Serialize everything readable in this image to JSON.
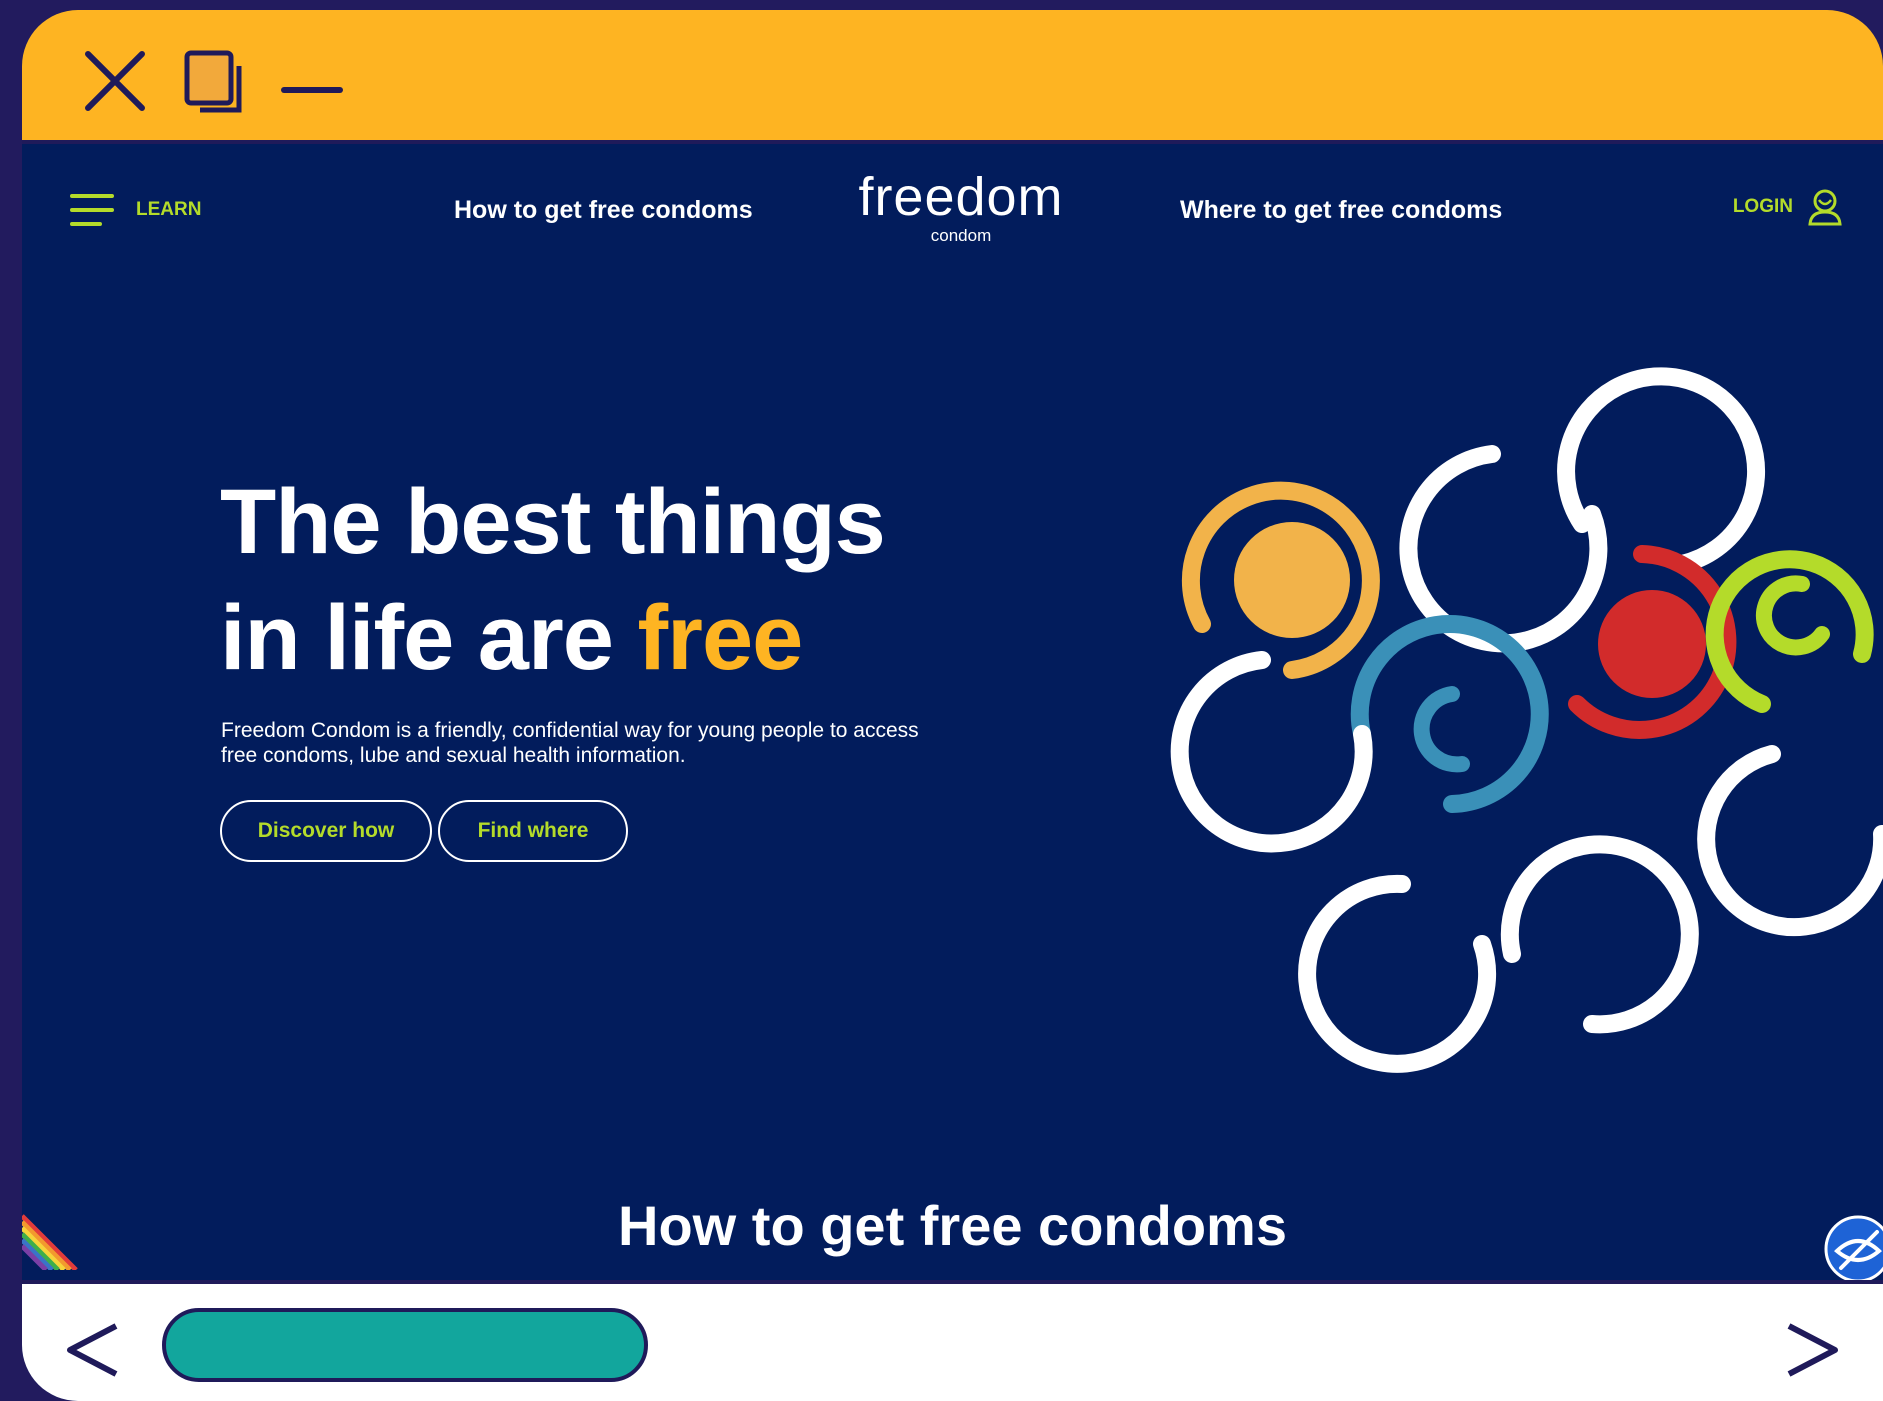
{
  "window": {
    "controls": {
      "close_icon": "close-icon",
      "restore_icon": "restore-icon",
      "minimize_icon": "minimize-icon"
    }
  },
  "nav": {
    "menu_label": "LEARN",
    "link_left": "How to get free condoms",
    "logo_word": "freedom",
    "logo_sub": "condom",
    "link_right": "Where to get free condoms",
    "login_label": "LOGIN"
  },
  "hero": {
    "title_line1": "The best things",
    "title_line2_prefix": "in life are ",
    "title_accent": "free",
    "description": "Freedom Condom is a friendly, confidential way for young people to access free condoms, lube and sexual health information.",
    "btn_discover": "Discover how",
    "btn_find": "Find where"
  },
  "section": {
    "title": "How to get free condoms"
  },
  "colors": {
    "background": "#021c5c",
    "accent_yellow": "#feb422",
    "accent_green": "#b4db2a",
    "titlebar": "#feb422",
    "scrollbar": "#12a69d"
  }
}
